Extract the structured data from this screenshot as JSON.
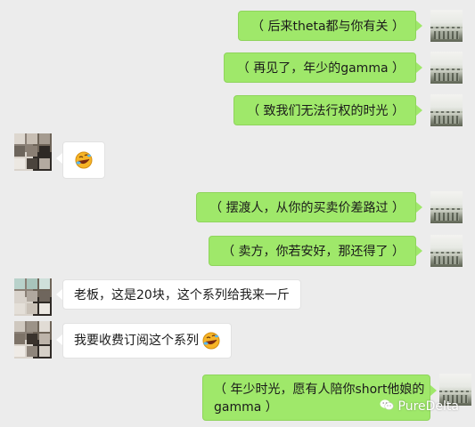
{
  "chat": {
    "background": "#ececec",
    "outgoing_bubble_color": "#9fe86a",
    "incoming_bubble_color": "#ffffff",
    "messages": [
      {
        "direction": "outgoing",
        "text": "（ 后来theta都与你有关 ）"
      },
      {
        "direction": "outgoing",
        "text": "（ 再见了，年少的gamma ）"
      },
      {
        "direction": "outgoing",
        "text": "（ 致我们无法行权的时光 ）"
      },
      {
        "direction": "incoming",
        "emoji": "rolling-on-floor-laughing-emoji"
      },
      {
        "direction": "outgoing",
        "text": "（ 摆渡人，从你的买卖价差路过 ）"
      },
      {
        "direction": "outgoing",
        "text": "（ 卖方，你若安好，那还得了 ）"
      },
      {
        "direction": "incoming",
        "text": "老板，这是20块，这个系列给我来一斤"
      },
      {
        "direction": "incoming",
        "text": "我要收费订阅这个系列",
        "emoji": "rolling-on-floor-laughing-emoji"
      },
      {
        "direction": "outgoing",
        "text_line1": "（ 年少时光，愿有人陪你short他娘的",
        "text_line2": "gamma ）"
      }
    ]
  },
  "watermark": {
    "text": "PureDelta",
    "icon": "wechat-official-account-icon"
  }
}
